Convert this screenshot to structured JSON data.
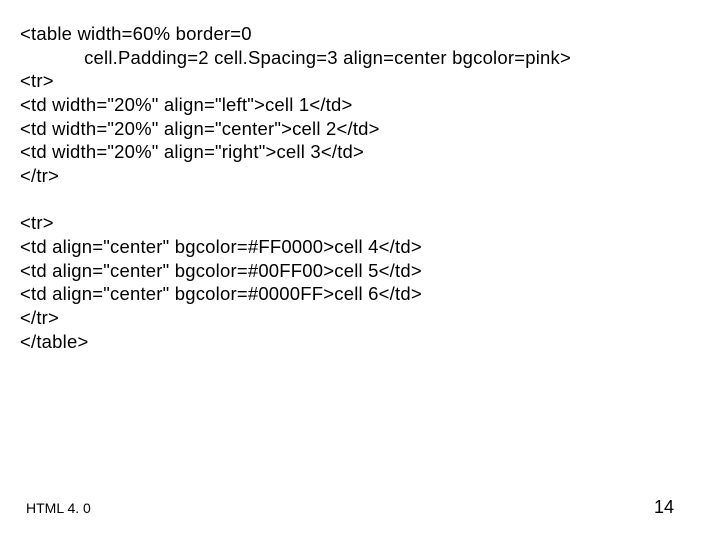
{
  "code": {
    "l1": "<table width=60% border=0",
    "l2": "            cell.Padding=2 cell.Spacing=3 align=center bgcolor=pink>",
    "l3": "<tr>",
    "l4": "<td width=\"20%\" align=\"left\">cell 1</td>",
    "l5": "<td width=\"20%\" align=\"center\">cell 2</td>",
    "l6": "<td width=\"20%\" align=\"right\">cell 3</td>",
    "l7": "</tr>",
    "l8": "",
    "l9": "<tr>",
    "l10": "<td align=\"center\" bgcolor=#FF0000>cell 4</td>",
    "l11": "<td align=\"center\" bgcolor=#00FF00>cell 5</td>",
    "l12": "<td align=\"center\" bgcolor=#0000FF>cell 6</td>",
    "l13": "</tr>",
    "l14": "</table>"
  },
  "footer": {
    "left": "HTML 4. 0",
    "page": "14"
  }
}
